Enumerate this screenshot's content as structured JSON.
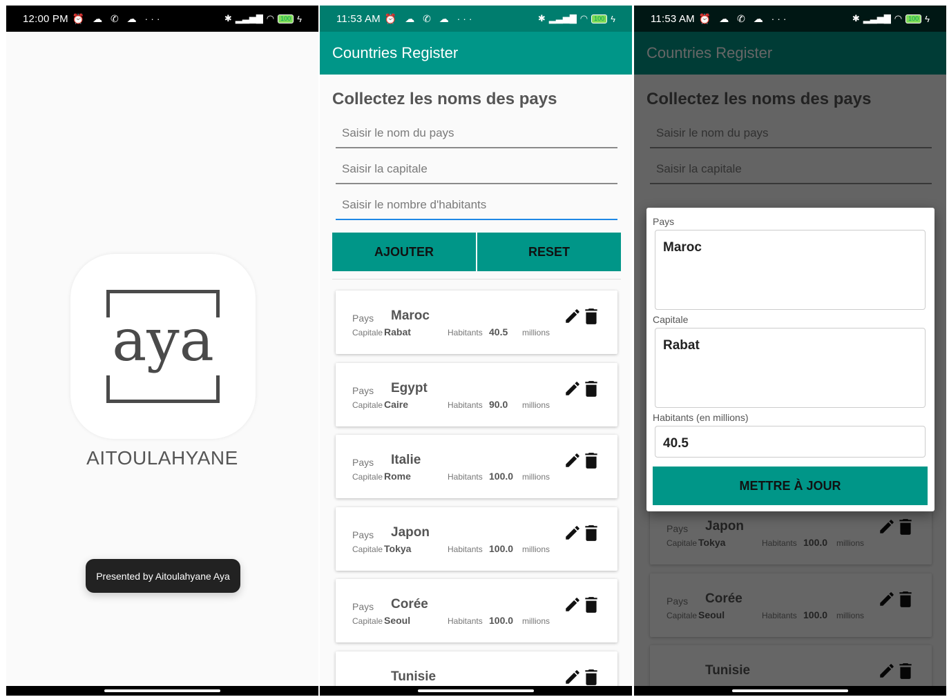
{
  "status": {
    "splash_time": "12:00 PM",
    "app_time": "11:53 AM",
    "left_icons": "⏰ ☁ ✆ ☁ ···",
    "battery": "100"
  },
  "splash": {
    "logo_word": "aya",
    "name": "AITOULAHYANE",
    "toast": "Presented by Aitoulahyane Aya"
  },
  "app": {
    "title": "Countries Register",
    "heading": "Collectez les noms des pays",
    "placeholder_country": "Saisir le nom du pays",
    "placeholder_capital": "Saisir la capitale",
    "placeholder_population": "Saisir le nombre d'habitants",
    "add_label": "AJOUTER",
    "reset_label": "RESET",
    "label_pays": "Pays",
    "label_capitale": "Capitale",
    "label_habitants": "Habitants",
    "label_millions": "millions",
    "countries": [
      {
        "pays": "Maroc",
        "capitale": "Rabat",
        "habitants": "40.5"
      },
      {
        "pays": "Egypt",
        "capitale": "Caire",
        "habitants": "90.0"
      },
      {
        "pays": "Italie",
        "capitale": "Rome",
        "habitants": "100.0"
      },
      {
        "pays": "Japon",
        "capitale": "Tokya",
        "habitants": "100.0"
      },
      {
        "pays": "Corée",
        "capitale": "Seoul",
        "habitants": "100.0"
      }
    ],
    "partial_country": "Tunisie"
  },
  "dialog": {
    "label_pays": "Pays",
    "value_pays": "Maroc",
    "label_capitale": "Capitale",
    "value_capitale": "Rabat",
    "label_habitants": "Habitants (en millions)",
    "value_habitants": "40.5",
    "update_label": "METTRE À JOUR"
  },
  "colors": {
    "primary": "#009688",
    "primary_dark": "#007d6e",
    "focus_underline": "#1e88e5"
  }
}
